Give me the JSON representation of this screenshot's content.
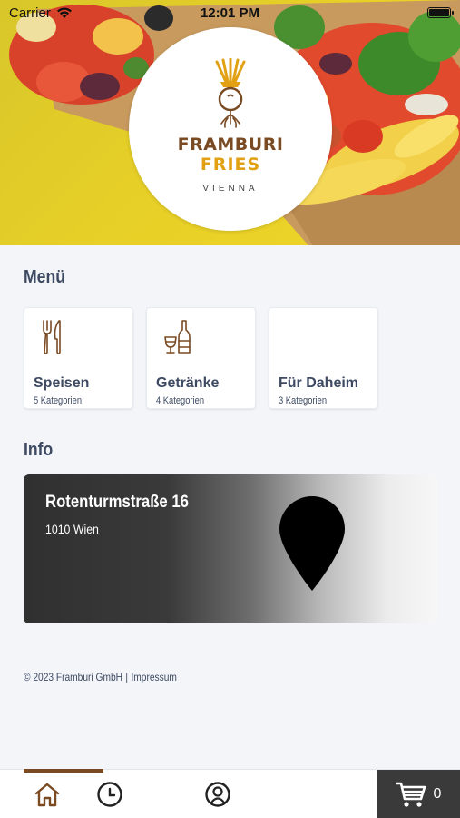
{
  "status_bar": {
    "carrier": "Carrier",
    "time": "12:01 PM",
    "battery_level": 1.0
  },
  "brand": {
    "name_line1": "FRAMBURI",
    "name_line2": "FRIES",
    "city": "VIENNA",
    "colors": {
      "brown": "#7a4a22",
      "gold": "#e2a114"
    }
  },
  "menu": {
    "title": "Menü",
    "categories": [
      {
        "label": "Speisen",
        "count_text": "5 Kategorien",
        "icon": "cutlery-icon"
      },
      {
        "label": "Getränke",
        "count_text": "4 Kategorien",
        "icon": "drinks-icon"
      },
      {
        "label": "Für Daheim",
        "count_text": "3 Kategorien",
        "icon": "none"
      }
    ]
  },
  "info": {
    "title": "Info",
    "street": "Rotenturmstraße 16",
    "city": "1010 Wien",
    "icon": "map-pin-icon"
  },
  "footer": {
    "copyright": "© 2023 Framburi GmbH",
    "separator": "|",
    "imprint_link": "Impressum"
  },
  "tabbar": {
    "items": [
      {
        "name": "home",
        "icon": "home-icon",
        "active": true
      },
      {
        "name": "history",
        "icon": "clock-icon",
        "active": false
      },
      {
        "name": "account",
        "icon": "user-icon",
        "active": false
      }
    ],
    "cart_icon": "cart-icon",
    "cart_count": "0",
    "colors": {
      "active_indicator": "#7a4a22",
      "cart_bg": "#3a3a3a"
    }
  }
}
